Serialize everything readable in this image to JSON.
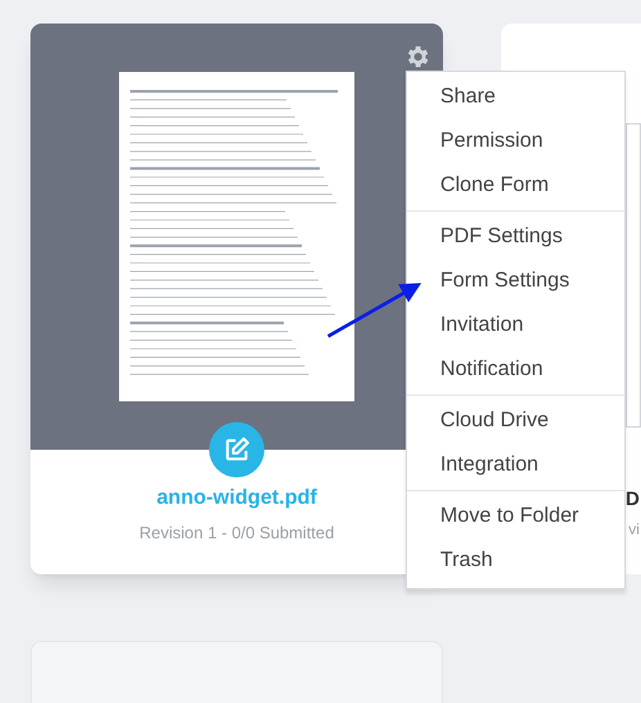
{
  "form_card": {
    "title": "anno-widget.pdf",
    "subtitle": "Revision 1 - 0/0 Submitted"
  },
  "next_card": {
    "title": "D",
    "subtitle": "vi"
  },
  "menu": {
    "groups": [
      [
        "Share",
        "Permission",
        "Clone Form"
      ],
      [
        "PDF Settings",
        "Form Settings",
        "Invitation",
        "Notification"
      ],
      [
        "Cloud Drive",
        "Integration"
      ],
      [
        "Move to Folder",
        "Trash"
      ]
    ]
  }
}
